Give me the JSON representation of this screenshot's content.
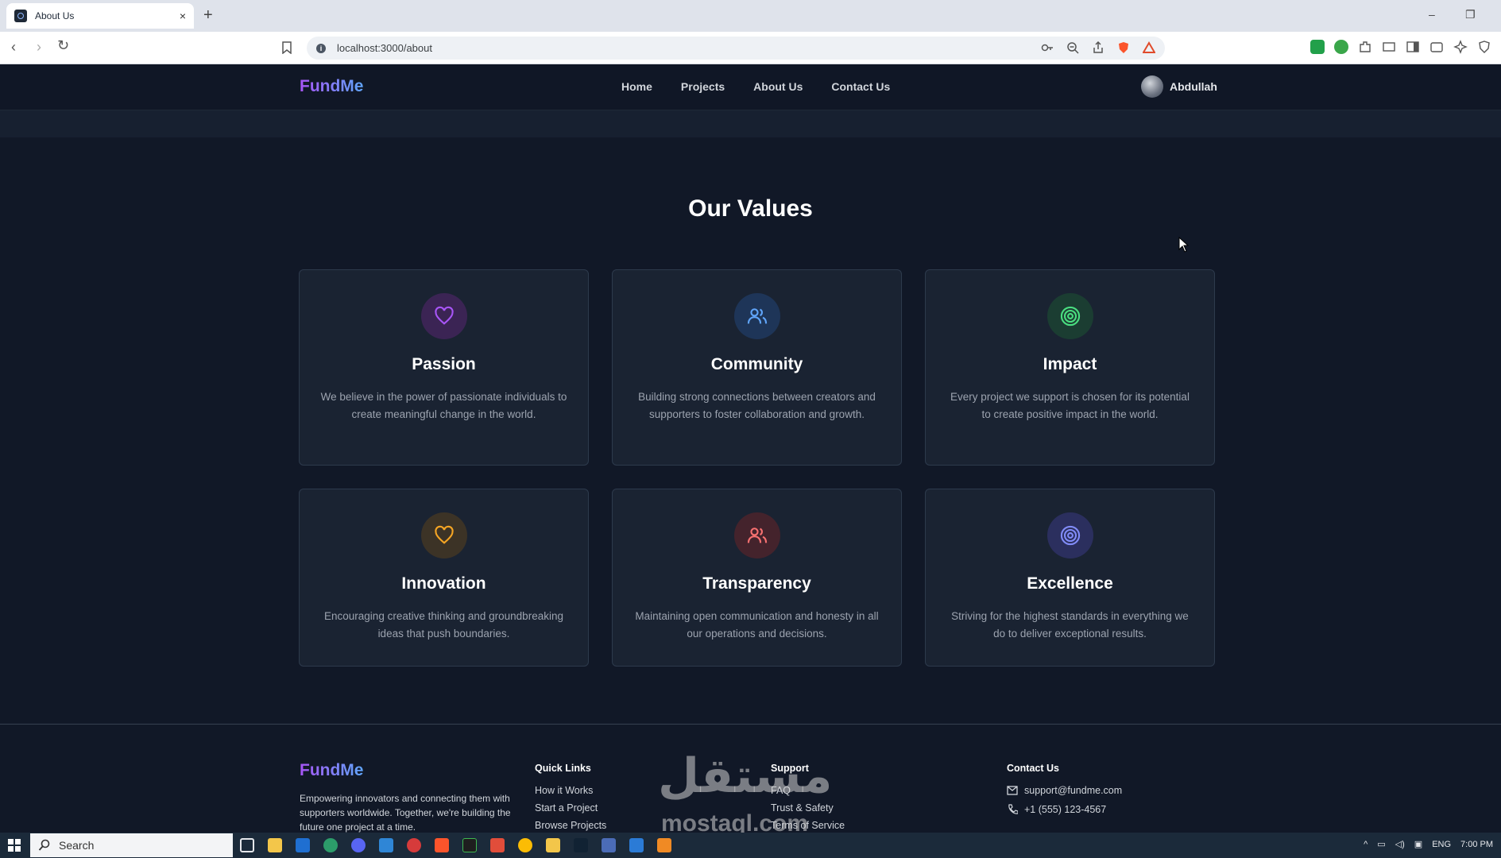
{
  "browser": {
    "tab_title": "About Us",
    "tab_close": "×",
    "new_tab": "+",
    "url": "localhost:3000/about",
    "minimize": "–",
    "restore": "❐"
  },
  "site": {
    "logo": "FundMe",
    "nav": [
      "Home",
      "Projects",
      "About Us",
      "Contact Us"
    ],
    "user_name": "Abdullah"
  },
  "values_section": {
    "title": "Our Values",
    "cards": [
      {
        "title": "Passion",
        "text": "We believe in the power of passionate individuals to create meaningful change in the world.",
        "icon": "heart-icon",
        "icon_color": "#a855f7",
        "icon_bg": "#3b2454"
      },
      {
        "title": "Community",
        "text": "Building strong connections between creators and supporters to foster collaboration and growth.",
        "icon": "users-icon",
        "icon_color": "#60a5fa",
        "icon_bg": "#1e3558"
      },
      {
        "title": "Impact",
        "text": "Every project we support is chosen for its potential to create positive impact in the world.",
        "icon": "target-icon",
        "icon_color": "#4ade80",
        "icon_bg": "#1b3d32"
      },
      {
        "title": "Innovation",
        "text": "Encouraging creative thinking and groundbreaking ideas that push boundaries.",
        "icon": "heart-icon",
        "icon_color": "#f5a524",
        "icon_bg": "#3c3326"
      },
      {
        "title": "Transparency",
        "text": "Maintaining open communication and honesty in all our operations and decisions.",
        "icon": "users-icon",
        "icon_color": "#f87171",
        "icon_bg": "#44232c"
      },
      {
        "title": "Excellence",
        "text": "Striving for the highest standards in everything we do to deliver exceptional results.",
        "icon": "target-icon",
        "icon_color": "#818cf8",
        "icon_bg": "#2b2f5e"
      }
    ]
  },
  "footer": {
    "logo": "FundMe",
    "description": "Empowering innovators and connecting them with supporters worldwide. Together, we're building the future one project at a time.",
    "quick_links": {
      "title": "Quick Links",
      "items": [
        "How it Works",
        "Start a Project",
        "Browse Projects"
      ]
    },
    "support": {
      "title": "Support",
      "items": [
        "FAQ",
        "Trust & Safety",
        "Terms of Service"
      ]
    },
    "contact": {
      "title": "Contact Us",
      "email": "support@fundme.com",
      "phone": "+1 (555) 123-4567"
    }
  },
  "watermark": {
    "text": "مستقل",
    "sub": "mostaql.com"
  },
  "taskbar": {
    "search_placeholder": "Search",
    "lang": "ENG",
    "time": "7:00 PM"
  }
}
